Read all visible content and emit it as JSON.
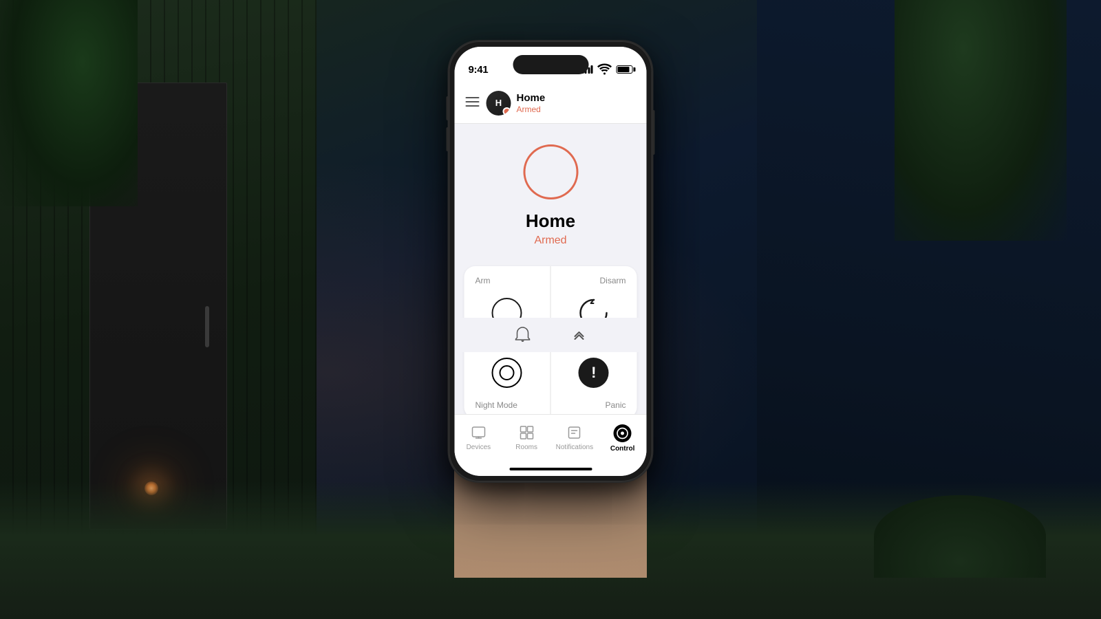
{
  "background": {
    "description": "Dark modern house exterior at night"
  },
  "phone": {
    "status_bar": {
      "time": "9:41",
      "signal_label": "signal",
      "wifi_label": "wifi",
      "battery_label": "battery"
    },
    "nav": {
      "menu_icon": "☰",
      "home_name": "Home",
      "home_status": "Armed"
    },
    "status_section": {
      "main_label": "Home",
      "status_label": "Armed"
    },
    "controls": {
      "arm_label": "Arm",
      "disarm_label": "Disarm",
      "night_mode_label": "Night Mode",
      "panic_label": "Panic"
    },
    "tab_bar": {
      "devices_label": "Devices",
      "rooms_label": "Rooms",
      "notifications_label": "Notifications",
      "control_label": "Control"
    }
  }
}
